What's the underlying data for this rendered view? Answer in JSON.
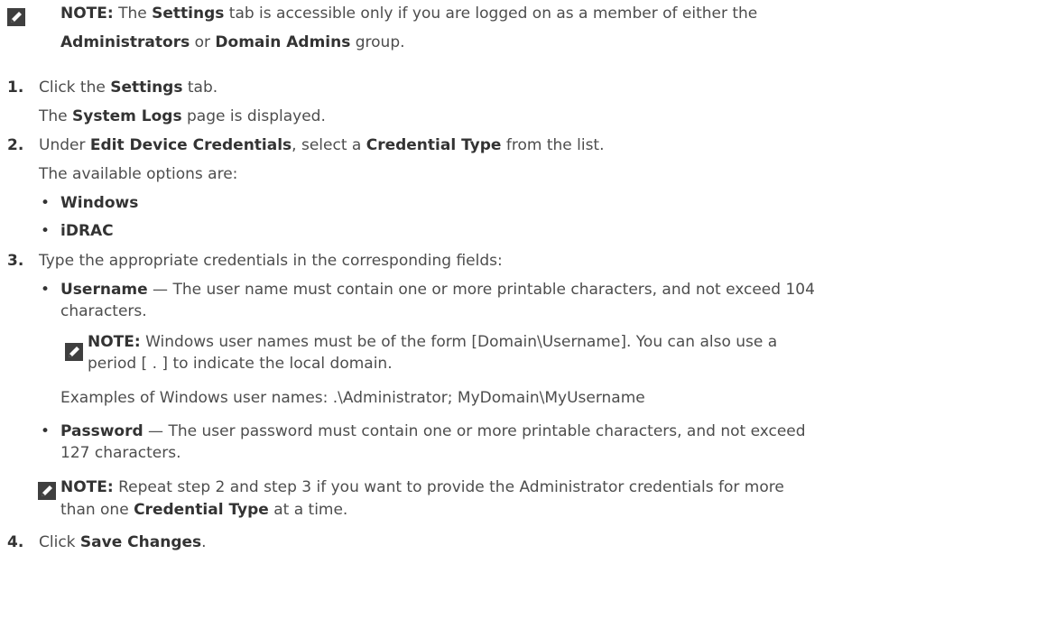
{
  "note1": {
    "label": "NOTE:",
    "p1": " The ",
    "settings": "Settings",
    "p2": " tab is accessible only if you are logged on as a member of either the",
    "administrators": "Administrators",
    "p3": " or ",
    "domain_admins": "Domain Admins",
    "p4": " group."
  },
  "step1": {
    "num": "1.",
    "p1": "Click the ",
    "settings": "Settings",
    "p2": " tab.",
    "result_p1": "The ",
    "system_logs": "System Logs",
    "result_p2": " page is displayed."
  },
  "step2": {
    "num": "2.",
    "p1": "Under ",
    "edit_device_credentials": "Edit Device Credentials",
    "p2": ", select a ",
    "credential_type": "Credential Type",
    "p3": " from the list.",
    "options_intro": "The available options are:",
    "options": [
      "Windows",
      "iDRAC"
    ]
  },
  "step3": {
    "num": "3.",
    "text": "Type the appropriate credentials in the corresponding fields:",
    "username": {
      "label": "Username",
      "dash": " — ",
      "desc_line1": "The user name must contain one or more printable characters, and not exceed 104",
      "desc_line2": "characters."
    },
    "note2": {
      "label": "NOTE:",
      "line1": " Windows user names must be of the form [Domain\\Username]. You can also use a",
      "line2": "period [ . ] to indicate the local domain."
    },
    "examples": "Examples of Windows user names: .\\Administrator; MyDomain\\MyUsername",
    "password": {
      "label": "Password",
      "dash": " — ",
      "desc_line1": "The user password must contain one or more printable characters, and not exceed",
      "desc_line2": "127 characters."
    },
    "note3": {
      "label": "NOTE:",
      "line1": " Repeat step 2 and step 3 if you want to provide the Administrator credentials for more",
      "line2_p1": "than one ",
      "credential_type": "Credential Type",
      "line2_p2": " at a time."
    }
  },
  "step4": {
    "num": "4.",
    "p1": "Click ",
    "save_changes": "Save Changes",
    "p2": "."
  },
  "icons": {
    "note": "note-pencil-icon"
  },
  "bullet_char": "•"
}
